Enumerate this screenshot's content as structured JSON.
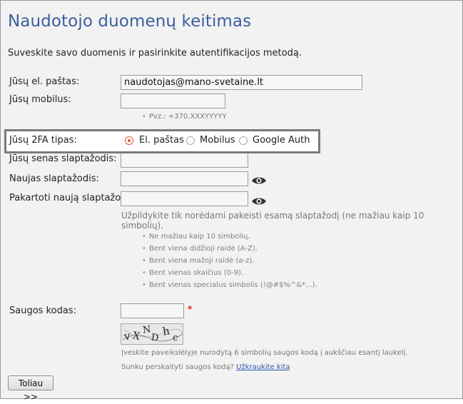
{
  "page": {
    "title": "Naudotojo duomenų keitimas",
    "intro": "Suveskite savo duomenis ir pasirinkite autentifikacijos metodą."
  },
  "form": {
    "email_label": "Jūsų el. paštas:",
    "email_value": "naudotojas@mano-svetaine.lt",
    "mobile_label": "Jūsų mobilus:",
    "mobile_value": "",
    "mobile_hint": "Pvz.: +370.XXXYYYYY",
    "twofa_label": "Jūsų 2FA tipas:",
    "twofa_options": [
      "El. paštas",
      "Mobilus",
      "Google Auth"
    ],
    "twofa_selected": "El. paštas",
    "old_password_label": "Jūsų senas slaptažodis:",
    "new_password_label": "Naujas slaptažodis:",
    "repeat_password_label": "Pakartoti naują slaptažodį:",
    "password_note": "Užpildykite tik norėdami pakeisti esamą slaptažodį (ne mažiau kaip 10 simbolių).",
    "password_rules": [
      "Ne mažiau kaip 10 simbolių.",
      "Bent viena didžioji raidė (A-Z).",
      "Bent viena mažoji raidė (a-z).",
      "Bent vienas skaičius (0-9).",
      "Bent vienas specialus simbolis (!@#$%^&*...)."
    ],
    "captcha_label": "Saugos kodas:",
    "captcha_required": "*",
    "captcha_text": [
      "v",
      "X",
      "N",
      "D",
      "h",
      "c"
    ],
    "captcha_instruction": "Įveskite paveikslėlyje nurodytą 6 simbolių saugos kodą į aukščiau esantį laukelį.",
    "captcha_reload_prompt": "Sunku perskaityti saugos kodą?",
    "captcha_reload_link": "Užkraukite kitą",
    "submit_label": "Toliau >>"
  },
  "colors": {
    "title": "#3a5f9e",
    "radio_accent": "#e0503a",
    "link": "#2a56a8"
  }
}
